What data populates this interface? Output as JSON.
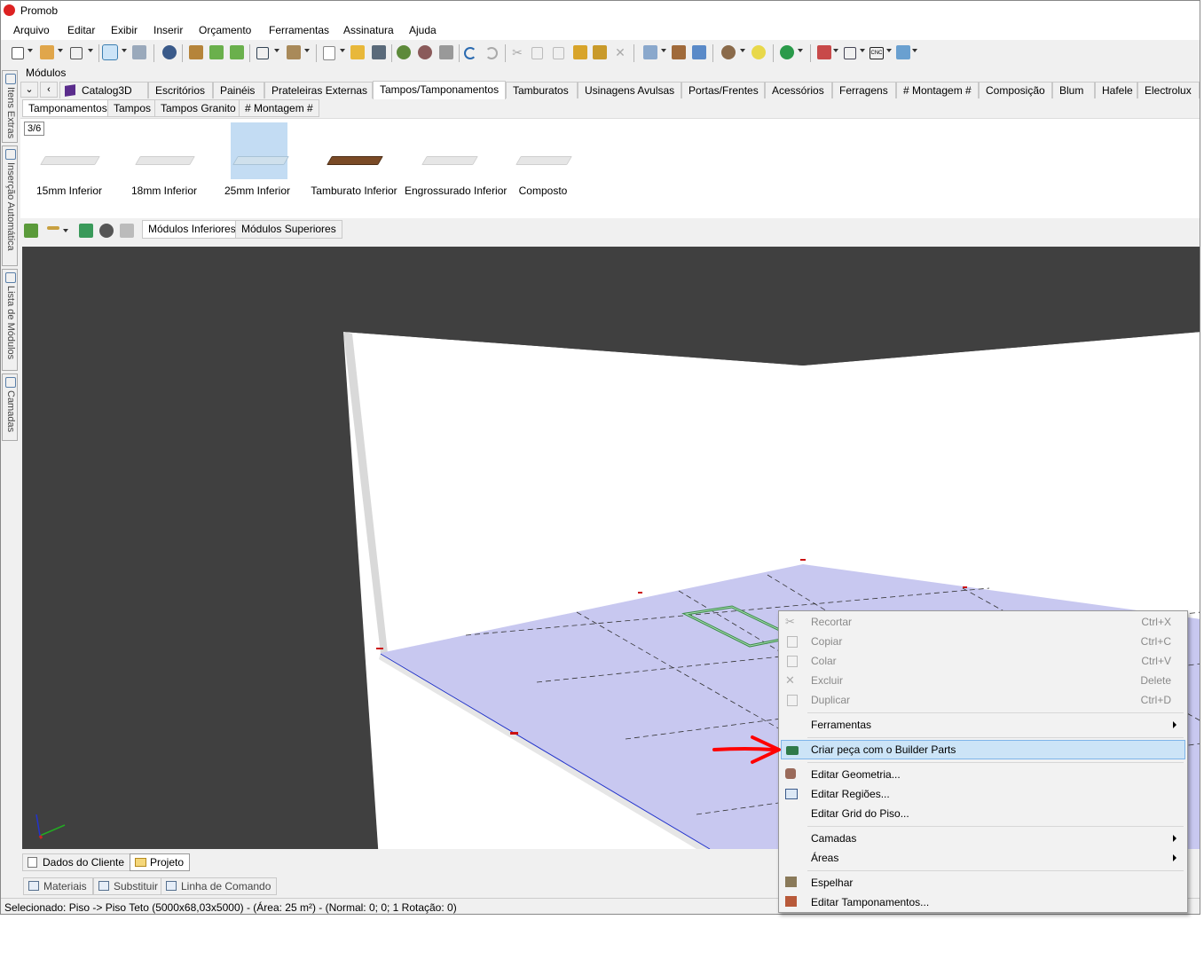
{
  "window": {
    "title": "Promob"
  },
  "menubar": [
    "Arquivo",
    "Editar",
    "Exibir",
    "Inserir",
    "Orçamento",
    "Ferramentas",
    "Assinatura",
    "Ajuda"
  ],
  "side_tabs": [
    "Itens Extras",
    "Inserção Automática",
    "Lista de Módulos",
    "Camadas"
  ],
  "modules_panel": {
    "title": "Módulos"
  },
  "nav": {
    "down": "⌄",
    "back": "‹"
  },
  "catalog_tabs": [
    "Catalog3D",
    "Escritórios",
    "Painéis",
    "Prateleiras Externas",
    "Tampos/Tamponamentos",
    "Tamburatos",
    "Usinagens Avulsas",
    "Portas/Frentes",
    "Acessórios",
    "Ferragens",
    "# Montagem #",
    "Composição",
    "Blum",
    "Hafele",
    "Electrolux"
  ],
  "subtabs": [
    "Tamponamentos",
    "Tampos",
    "Tampos Granito",
    "# Montagem #"
  ],
  "gallery": {
    "pager": "3/6",
    "items": [
      {
        "label": "15mm Inferior",
        "color": "#e4e4e4"
      },
      {
        "label": "18mm Inferior",
        "color": "#e4e4e4"
      },
      {
        "label": "25mm Inferior",
        "color": "#d9e6ef"
      },
      {
        "label": "Tamburato Inferior",
        "color": "#7a4a26"
      },
      {
        "label": "Engrossurado Inferior",
        "color": "#e4e4e4"
      },
      {
        "label": "Composto",
        "color": "#e4e4e4"
      }
    ]
  },
  "view_buttons": [
    "Módulos Inferiores",
    "Módulos Superiores"
  ],
  "bottom_tabs": [
    "Dados do Cliente",
    "Projeto"
  ],
  "panel_tabs": [
    "Materiais",
    "Substituir",
    "Linha de Comando"
  ],
  "status": "Selecionado: Piso -> Piso Teto (5000x68,03x5000) - (Área: 25 m²) - (Normal: 0; 0; 1 Rotação: 0)",
  "context_menu": {
    "items": [
      {
        "label": "Recortar",
        "shortcut": "Ctrl+X",
        "disabled": true,
        "icon": "scissors-icon"
      },
      {
        "label": "Copiar",
        "shortcut": "Ctrl+C",
        "disabled": true,
        "icon": "copy-icon"
      },
      {
        "label": "Colar",
        "shortcut": "Ctrl+V",
        "disabled": true,
        "icon": "paste-icon"
      },
      {
        "label": "Excluir",
        "shortcut": "Delete",
        "disabled": true,
        "icon": "delete-x-icon"
      },
      {
        "label": "Duplicar",
        "shortcut": "Ctrl+D",
        "disabled": true,
        "icon": "duplicate-icon"
      },
      {
        "label": "Ferramentas",
        "submenu": true
      },
      {
        "label": "Criar peça com o Builder Parts",
        "highlighted": true,
        "icon": "builder-parts-icon"
      },
      {
        "label": "Editar Geometria...",
        "icon": "edit-geometry-icon"
      },
      {
        "label": "Editar Regiões...",
        "icon": "edit-regions-icon"
      },
      {
        "label": "Editar Grid do Piso..."
      },
      {
        "label": "Camadas",
        "submenu": true
      },
      {
        "label": "Áreas",
        "submenu": true
      },
      {
        "label": "Espelhar",
        "icon": "mirror-icon"
      },
      {
        "label": "Editar Tamponamentos...",
        "icon": "edit-panels-icon"
      }
    ]
  },
  "colors": {
    "accent": "#cce4f7",
    "viewport_bg": "#404040",
    "floor": "#c8c8f0",
    "annotation_arrow": "#ff0000"
  }
}
